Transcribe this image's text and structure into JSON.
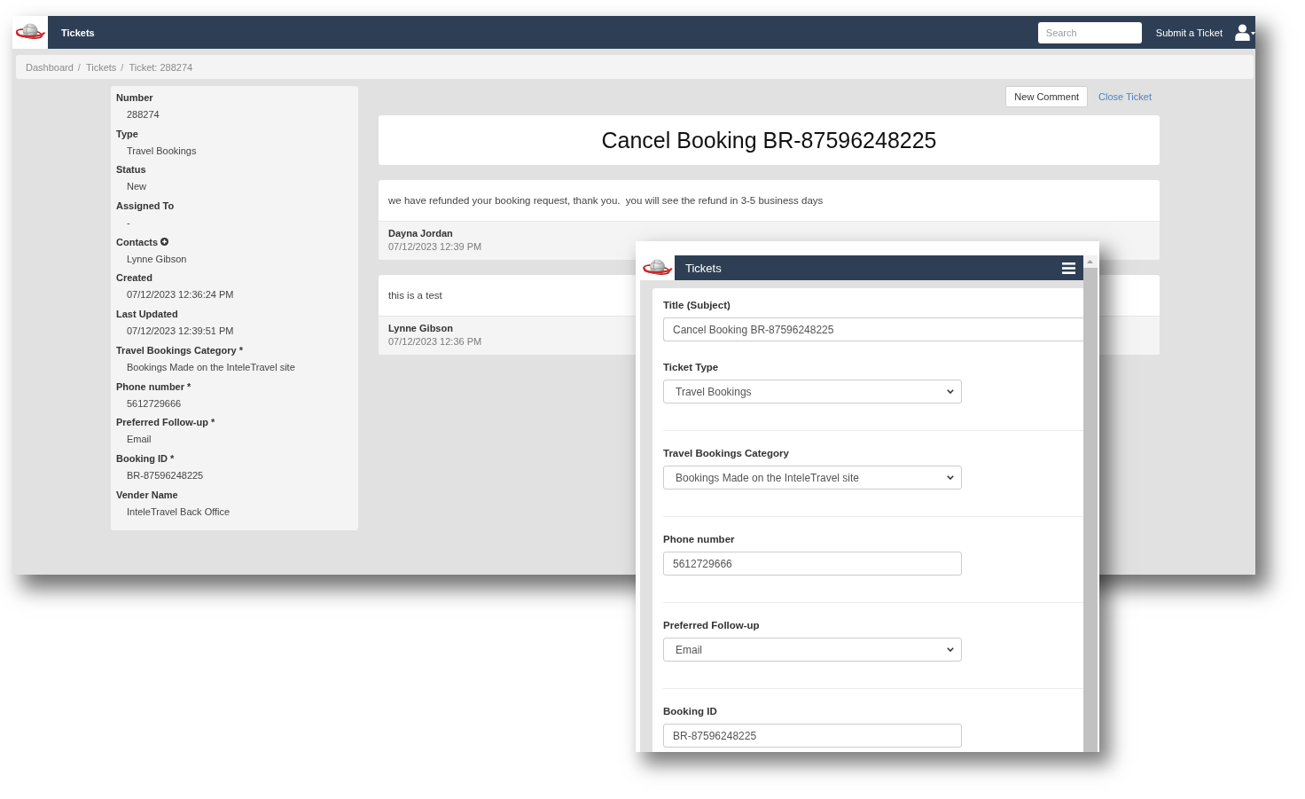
{
  "navbar": {
    "title": "Tickets",
    "search": {
      "placeholder": "Search"
    },
    "submit_link": "Submit a Ticket"
  },
  "breadcrumb": [
    {
      "label": "Dashboard",
      "separator": "/"
    },
    {
      "label": "Tickets",
      "separator": "/"
    },
    {
      "label": "Ticket: 288274"
    }
  ],
  "details": [
    {
      "label": "Number",
      "value": "288274",
      "kind": "plain"
    },
    {
      "label": "Type",
      "value": "Travel Bookings",
      "kind": "plain"
    },
    {
      "label": "Status",
      "value": "New",
      "kind": "plain"
    },
    {
      "label": "Assigned To",
      "value": "-",
      "kind": "plain"
    },
    {
      "label": "Contacts",
      "value": "Lynne Gibson",
      "kind": "addable"
    },
    {
      "label": "Created",
      "value": "07/12/2023 12:36:24 PM",
      "kind": "plain"
    },
    {
      "label": "Last Updated",
      "value": "07/12/2023 12:39:51 PM",
      "kind": "plain"
    },
    {
      "label": "Travel Bookings Category *",
      "value": "Bookings Made on the InteleTravel site",
      "kind": "plain"
    },
    {
      "label": "Phone number *",
      "value": "5612729666",
      "kind": "plain"
    },
    {
      "label": "Preferred Follow-up *",
      "value": "Email",
      "kind": "plain"
    },
    {
      "label": "Booking ID *",
      "value": "BR-87596248225",
      "kind": "plain"
    },
    {
      "label": "Vender Name",
      "value": "InteleTravel Back Office",
      "kind": "plain"
    }
  ],
  "actions": [
    {
      "label": "New Comment",
      "kind": "button"
    },
    {
      "label": "Close Ticket",
      "kind": "link"
    }
  ],
  "ticket_title": "Cancel Booking BR-87596248225",
  "comments": [
    {
      "body": "we have refunded your booking request, thank you.  you will see the refund in 3-5 business days",
      "author": "Dayna Jordan",
      "time": "07/12/2023 12:39 PM"
    },
    {
      "body": "this is a test",
      "author": "Lynne Gibson",
      "time": "07/12/2023 12:36 PM"
    }
  ],
  "mobile_window": {
    "navbar": {
      "title": "Tickets"
    },
    "sections": [
      {
        "fields": [
          {
            "label": "Title (Subject)",
            "kind": "title",
            "value": "Cancel Booking BR-87596248225"
          },
          {
            "label": "Ticket Type",
            "kind": "select",
            "value": "Travel Bookings"
          }
        ]
      },
      {
        "fields": [
          {
            "label": "Travel Bookings Category",
            "kind": "select",
            "value": "Bookings Made on the InteleTravel site"
          }
        ]
      },
      {
        "fields": [
          {
            "label": "Phone number",
            "kind": "text",
            "value": "5612729666"
          }
        ]
      },
      {
        "fields": [
          {
            "label": "Preferred Follow-up",
            "kind": "select",
            "value": "Email"
          }
        ]
      },
      {
        "fields": [
          {
            "label": "Booking ID",
            "kind": "text",
            "value": "BR-87596248225"
          }
        ]
      }
    ]
  }
}
